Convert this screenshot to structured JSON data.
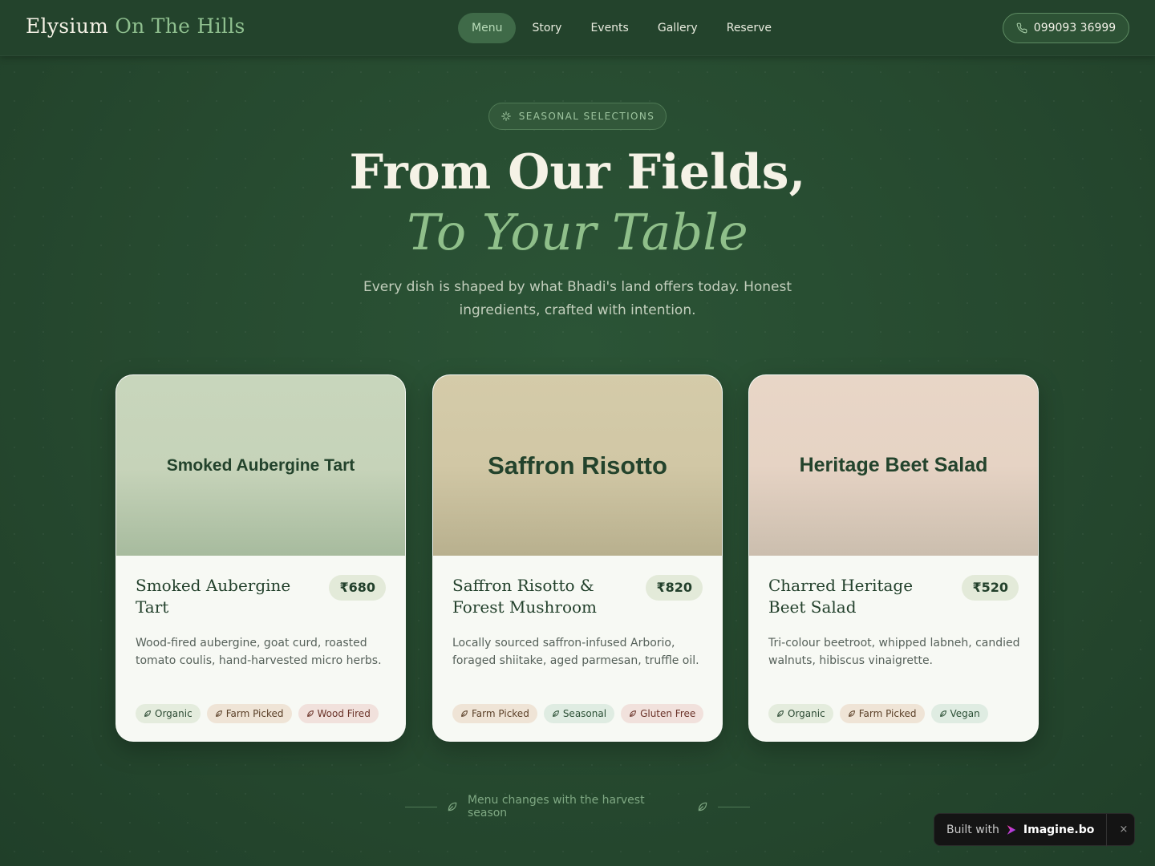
{
  "header": {
    "brand_main": "Elysium",
    "brand_accent": "On The Hills",
    "nav": [
      {
        "label": "Menu",
        "active": true
      },
      {
        "label": "Story",
        "active": false
      },
      {
        "label": "Events",
        "active": false
      },
      {
        "label": "Gallery",
        "active": false
      },
      {
        "label": "Reserve",
        "active": false
      }
    ],
    "phone": "099093 36999",
    "phone_icon": "phone-icon"
  },
  "hero": {
    "badge": "SEASONAL SELECTIONS",
    "badge_icon": "sparkle-icon",
    "title_line1": "From Our Fields,",
    "title_line2": "To Your Table",
    "subtitle": "Every dish is shaped by what Bhadi's land offers today. Honest ingredients, crafted with intention."
  },
  "cards": [
    {
      "image_label": "Smoked Aubergine Tart",
      "title": "Smoked Aubergine Tart",
      "price": "₹680",
      "description": "Wood-fired aubergine, goat curd, roasted tomato coulis, hand-harvested micro herbs.",
      "tags": [
        "Organic",
        "Farm Picked",
        "Wood Fired"
      ]
    },
    {
      "image_label": "Saffron Risotto",
      "title": "Saffron Risotto & Forest Mushroom",
      "price": "₹820",
      "description": "Locally sourced saffron-infused Arborio, foraged shiitake, aged parmesan, truffle oil.",
      "tags": [
        "Farm Picked",
        "Seasonal",
        "Gluten Free"
      ]
    },
    {
      "image_label": "Heritage Beet Salad",
      "title": "Charred Heritage Beet Salad",
      "price": "₹520",
      "description": "Tri-colour beetroot, whipped labneh, candied walnuts, hibiscus vinaigrette.",
      "tags": [
        "Organic",
        "Farm Picked",
        "Vegan"
      ]
    }
  ],
  "footnote": "Menu changes with the harvest season",
  "built_with": {
    "label": "Built with",
    "brand": "Imagine.bo",
    "close": "×"
  },
  "colors": {
    "background": "#26492f",
    "accent_green": "#8fbf8a",
    "card": "#f7f9f4",
    "text_dark": "#22402b"
  }
}
